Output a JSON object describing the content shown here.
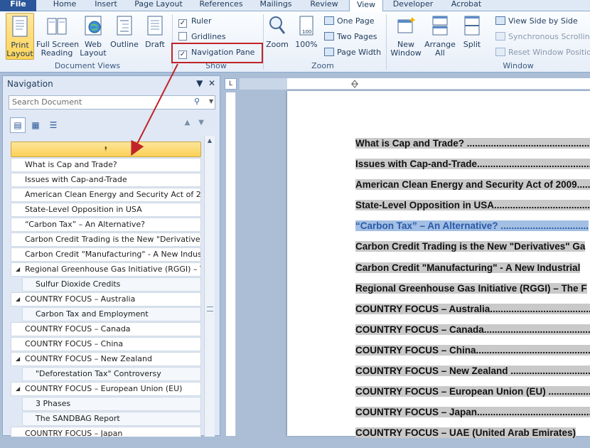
{
  "ribbon_tabs": [
    "File",
    "Home",
    "Insert",
    "Page Layout",
    "References",
    "Mailings",
    "Review",
    "View",
    "Developer",
    "Acrobat"
  ],
  "active_tab": "View",
  "document_views": {
    "buttons": [
      {
        "label1": "Print",
        "label2": "Layout",
        "icon": "print-layout-icon",
        "selected": true
      },
      {
        "label1": "Full Screen",
        "label2": "Reading",
        "icon": "full-screen-reading-icon",
        "selected": false
      },
      {
        "label1": "Web",
        "label2": "Layout",
        "icon": "web-layout-icon",
        "selected": false
      },
      {
        "label1": "Outline",
        "label2": "",
        "icon": "outline-icon",
        "selected": false
      },
      {
        "label1": "Draft",
        "label2": "",
        "icon": "draft-icon",
        "selected": false
      }
    ],
    "group_label": "Document Views"
  },
  "show": {
    "ruler": {
      "label": "Ruler",
      "checked": true
    },
    "gridlines": {
      "label": "Gridlines",
      "checked": false
    },
    "navigation_pane": {
      "label": "Navigation Pane",
      "checked": true
    },
    "group_label": "Show"
  },
  "zoom": {
    "zoom_label": "Zoom",
    "percent_label": "100%",
    "one_page": "One Page",
    "two_pages": "Two Pages",
    "page_width": "Page Width",
    "group_label": "Zoom"
  },
  "window": {
    "new_window1": "New",
    "new_window2": "Window",
    "arrange_all1": "Arrange",
    "arrange_all2": "All",
    "split": "Split",
    "view_side_by_side": "View Side by Side",
    "synchronous_scrolling": "Synchronous Scrolling",
    "reset_window_position": "Reset Window Position",
    "group_label": "Window"
  },
  "navigation_pane": {
    "title": "Navigation",
    "search_placeholder": "Search Document",
    "headings": [
      {
        "text": "What is Cap and Trade?",
        "level": 1,
        "expanded": null
      },
      {
        "text": "Issues with Cap-and-Trade",
        "level": 1,
        "expanded": null
      },
      {
        "text": "American Clean Energy and Security Act of 2009",
        "level": 1,
        "expanded": null
      },
      {
        "text": "State-Level Opposition in USA",
        "level": 1,
        "expanded": null
      },
      {
        "text": "“Carbon Tax” – An Alternative?",
        "level": 1,
        "expanded": null
      },
      {
        "text": "Carbon Credit Trading is the New \"Derivatives\"...",
        "level": 1,
        "expanded": null
      },
      {
        "text": "Carbon Credit \"Manufacturing\" - A New Indus...",
        "level": 1,
        "expanded": null
      },
      {
        "text": "Regional Greenhouse Gas Initiative (RGGI) – T...",
        "level": 1,
        "expanded": true
      },
      {
        "text": "Sulfur Dioxide Credits",
        "level": 2,
        "expanded": null
      },
      {
        "text": "COUNTRY FOCUS – Australia",
        "level": 1,
        "expanded": true
      },
      {
        "text": "Carbon Tax and Employment",
        "level": 2,
        "expanded": null
      },
      {
        "text": "COUNTRY FOCUS – Canada",
        "level": 1,
        "expanded": null
      },
      {
        "text": "COUNTRY FOCUS – China",
        "level": 1,
        "expanded": null
      },
      {
        "text": "COUNTRY FOCUS – New Zealand",
        "level": 1,
        "expanded": true
      },
      {
        "text": "\"Deforestation Tax\" Controversy",
        "level": 2,
        "expanded": null
      },
      {
        "text": "COUNTRY FOCUS – European Union (EU)",
        "level": 1,
        "expanded": true
      },
      {
        "text": "3 Phases",
        "level": 2,
        "expanded": null
      },
      {
        "text": "The SANDBAG Report",
        "level": 2,
        "expanded": null
      },
      {
        "text": "COUNTRY FOCUS – Japan",
        "level": 1,
        "expanded": null
      }
    ]
  },
  "document": {
    "toc": [
      {
        "text": "What is Cap and Trade? ...................................................",
        "highlighted": false
      },
      {
        "text": "Issues with Cap-and-Trade...............................................",
        "highlighted": false
      },
      {
        "text": "American Clean Energy and Security Act of 2009.........",
        "highlighted": false
      },
      {
        "text": "State-Level Opposition in USA........................................",
        "highlighted": false
      },
      {
        "text": "“Carbon Tax” – An Alternative? .................................",
        "highlighted": true
      },
      {
        "text": "Carbon Credit Trading is the New \"Derivatives\" Ga",
        "highlighted": false
      },
      {
        "text": "Carbon Credit \"Manufacturing\" - A New Industrial",
        "highlighted": false
      },
      {
        "text": "Regional Greenhouse Gas Initiative (RGGI) – The F",
        "highlighted": false
      },
      {
        "text": "COUNTRY FOCUS – Australia..........................................",
        "highlighted": false
      },
      {
        "text": "COUNTRY FOCUS – Canada...............................................",
        "highlighted": false
      },
      {
        "text": "COUNTRY FOCUS – China.................................................",
        "highlighted": false
      },
      {
        "text": "COUNTRY FOCUS – New Zealand ....................................",
        "highlighted": false
      },
      {
        "text": "COUNTRY FOCUS – European Union (EU) ......................",
        "highlighted": false
      },
      {
        "text": "COUNTRY FOCUS – Japan.................................................",
        "highlighted": false
      },
      {
        "text": "COUNTRY FOCUS – UAE (United Arab Emirates)",
        "highlighted": false
      }
    ]
  },
  "ruler_corner_symbol": "L",
  "colors": {
    "file_tab": "#2b579a",
    "selected_yellow": "#fbd054",
    "highlight_annotation": "#c0242a",
    "toc_highlight": "#a3bfe3"
  }
}
